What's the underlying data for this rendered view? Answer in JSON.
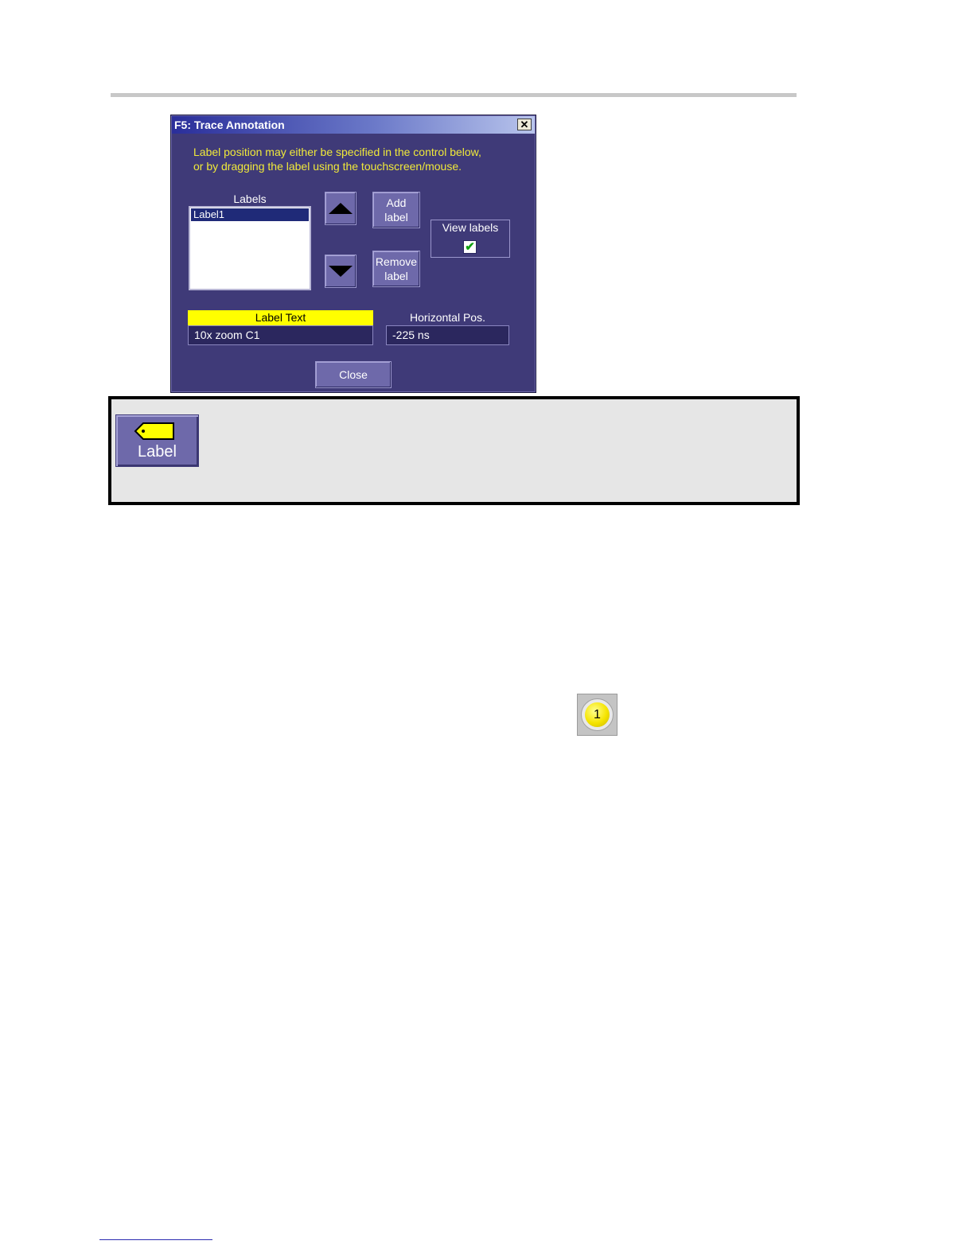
{
  "dialog": {
    "title": "F5: Trace Annotation",
    "close_glyph": "✕",
    "info_line1": "Label position may either be specified in the control below,",
    "info_line2": "or by dragging the label using the touchscreen/mouse.",
    "labels_heading": "Labels",
    "labels_list": [
      "Label1"
    ],
    "selected_label": "Label1",
    "add_label_line1": "Add",
    "add_label_line2": "label",
    "remove_label_line1": "Remove",
    "remove_label_line2": "label",
    "view_labels": "View labels",
    "view_labels_checked": true,
    "checkmark_glyph": "✔",
    "label_text_heading": "Label Text",
    "label_text_value": "10x zoom C1",
    "horizontal_pos_heading": "Horizontal Pos.",
    "horizontal_pos_value": "-225 ns",
    "close_button": "Close"
  },
  "toolbar_icon": {
    "label": "Label",
    "icon": "tag-icon",
    "tag_color": "#ffff00"
  },
  "marker_icon": {
    "number": "1",
    "color": "#f5e400"
  },
  "colors": {
    "dialog_bg": "#3f3a78",
    "info_text": "#f0e93a",
    "highlight_header": "#ffff00"
  }
}
